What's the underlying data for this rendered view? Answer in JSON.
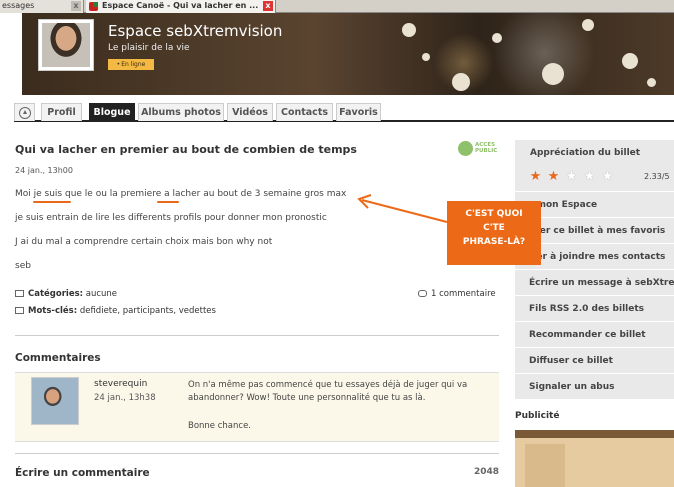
{
  "browser": {
    "tabs": [
      {
        "label": "essages",
        "active": false
      },
      {
        "label": "Espace Canoë - Qui va lacher en ...",
        "active": true
      }
    ],
    "close_glyph": "x"
  },
  "profile": {
    "site_title": "Espace sebXtremvision",
    "subtitle": "Le plaisir de la vie",
    "status_badge": "En ligne"
  },
  "nav": {
    "items": [
      "Profil",
      "Blogue",
      "Albums photos",
      "Vidéos",
      "Contacts",
      "Favoris"
    ],
    "active": "Blogue"
  },
  "post": {
    "title": "Qui va lacher en premier au bout de combien de temps",
    "date": "24 jan., 13h00",
    "access_badge": [
      "ACCES",
      "PUBLIC"
    ],
    "lines": [
      "Moi je suis que le ou la premiere a lacher au bout de 3 semaine gros max",
      "je suis entrain de lire les differents profils pour donner mon pronostic",
      "J ai du mal a comprendre certain choix mais bon why not",
      "seb"
    ],
    "categories_label": "Catégories:",
    "categories_value": "aucune",
    "tags_label": "Mots-clés:",
    "tags_value": "defidiete, participants, vedettes",
    "comment_count": "1 commentaire"
  },
  "comments": {
    "title": "Commentaires",
    "items": [
      {
        "author": "steverequin",
        "date": "24 jan., 13h38",
        "text": "On n'a même pas commencé que tu essayes déjà de juger qui va abandonner? Wow! Toute une personnalité que tu as là.",
        "closing": "Bonne chance."
      }
    ]
  },
  "write_comment": {
    "title": "Écrire un commentaire",
    "char_count": "2048"
  },
  "sidebar": {
    "rating_title": "Appréciation du billet",
    "rating_stars_filled": 2,
    "rating_stars_total": 5,
    "rating_value": "2.33/5",
    "items": [
      "r mon Espace",
      "uter ce billet à mes favoris",
      "iter à joindre mes contacts",
      "Écrire un message à sebXtrem",
      "Fils RSS 2.0 des billets",
      "Recommander ce billet",
      "Diffuser ce billet",
      "Signaler un abus"
    ],
    "ad_label": "Publicité"
  },
  "annotation": {
    "lines": [
      "C'EST QUOI",
      "C'TE",
      "PHRASE-LÀ?"
    ],
    "color": "#ec6a17"
  }
}
